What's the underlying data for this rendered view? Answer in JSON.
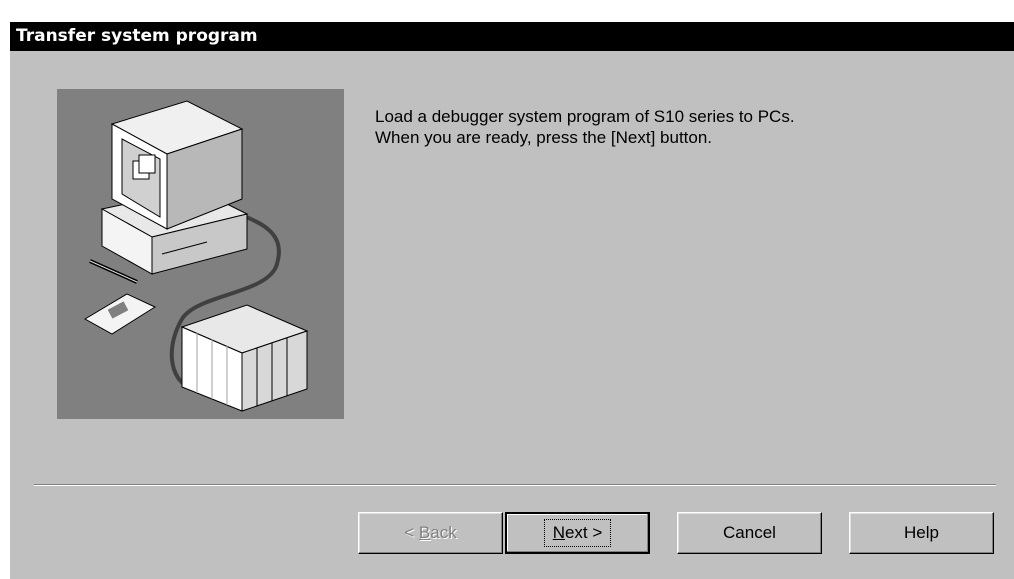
{
  "window": {
    "title": "Transfer system program"
  },
  "message": {
    "line1": "Load a debugger system program of S10 series to PCs.",
    "line2": "When you are ready, press the [Next] button."
  },
  "buttons": {
    "back": {
      "prefix": "< ",
      "mnemonic": "B",
      "rest": "ack",
      "enabled": false
    },
    "next": {
      "mnemonic": "N",
      "rest": "ext >",
      "enabled": true,
      "default": true
    },
    "cancel": {
      "label": "Cancel",
      "enabled": true
    },
    "help": {
      "label": "Help",
      "enabled": true
    }
  },
  "illustration": {
    "icon": "computer-to-plc-transfer-illustration",
    "background_color": "#808080"
  }
}
